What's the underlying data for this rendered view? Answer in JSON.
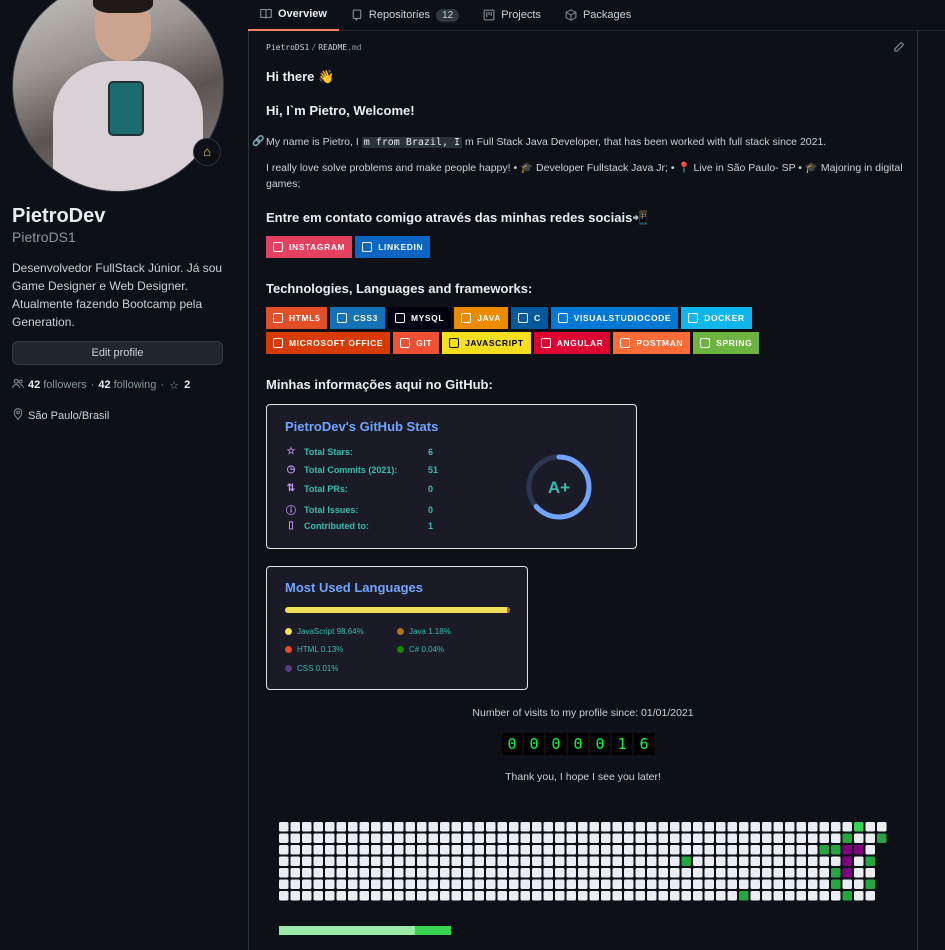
{
  "nav": {
    "tabs": [
      {
        "label": "Overview",
        "icon": "book-icon",
        "active": true
      },
      {
        "label": "Repositories",
        "icon": "repo-icon",
        "count": "12"
      },
      {
        "label": "Projects",
        "icon": "project-icon"
      },
      {
        "label": "Packages",
        "icon": "package-icon"
      }
    ]
  },
  "profile": {
    "display_name": "PietroDev",
    "username": "PietroDS1",
    "bio": "Desenvolvedor FullStack Júnior. Já sou Game Designer e Web Designer. Atualmente fazendo Bootcamp pela Generation.",
    "edit_label": "Edit profile",
    "followers_count": "42",
    "followers_label": "followers",
    "following_count": "42",
    "following_label": "following",
    "stars": "2",
    "location": "São Paulo/Brasil",
    "status_emoji": "house-icon"
  },
  "readme": {
    "crumb_user": "PietroDS1",
    "crumb_sep": "/",
    "crumb_file": "README",
    "crumb_ext": ".md",
    "greeting": "Hi there 👋",
    "welcome": "Hi, I`m Pietro, Welcome!",
    "intro_1": "My name is Pietro, I",
    "intro_code_1": "m from Brazil, I",
    "intro_2": "m Full Stack Java Developer, that has been worked with full stack since 2021.",
    "about": "I really love solve problems and make people happy! • 🎓 Developer Fullstack Java Jr; • 📍 Live in São Paulo- SP • 🎓 Majoring in digital games;",
    "contact_heading": "Entre em contato comigo através das minhas redes sociais📲",
    "social_badges": [
      {
        "label": "INSTAGRAM",
        "color": "#E4405F",
        "icon": "instagram-icon"
      },
      {
        "label": "LINKEDIN",
        "color": "#0A66C2",
        "icon": "linkedin-icon"
      }
    ],
    "tech_heading": "Technologies, Languages and frameworks:",
    "tech_badges": [
      {
        "label": "HTML5",
        "color": "#E34F26"
      },
      {
        "label": "CSS3",
        "color": "#1572B6"
      },
      {
        "label": "MYSQL",
        "color": "#00000F"
      },
      {
        "label": "JAVA",
        "color": "#ED8B00"
      },
      {
        "label": "C",
        "color": "#00599C"
      },
      {
        "label": "VISUALSTUDIOCODE",
        "color": "#0078D4"
      },
      {
        "label": "DOCKER",
        "color": "#0DB7ED"
      },
      {
        "label": "MICROSOFT OFFICE",
        "color": "#D83B01"
      },
      {
        "label": "GIT",
        "color": "#F05033"
      },
      {
        "label": "JAVASCRIPT",
        "color": "#F7DF1E",
        "text_color": "#000000"
      },
      {
        "label": "ANGULAR",
        "color": "#DD0031"
      },
      {
        "label": "POSTMAN",
        "color": "#FF6C37"
      },
      {
        "label": "SPRING",
        "color": "#6DB33F"
      }
    ],
    "github_heading": "Minhas informações aqui no GitHub:",
    "stats": {
      "title": "PietroDev's GitHub Stats",
      "rows": [
        {
          "label": "Total Stars:",
          "value": "6",
          "icon": "star-icon"
        },
        {
          "label": "Total Commits (2021):",
          "value": "51",
          "icon": "history-icon"
        },
        {
          "label": "Total PRs:",
          "value": "0",
          "icon": "pull-request-icon"
        },
        {
          "label": "Total Issues:",
          "value": "0",
          "icon": "issue-icon"
        },
        {
          "label": "Contributed to:",
          "value": "1",
          "icon": "repo-icon"
        }
      ],
      "grade": "A+",
      "ring_color": "#70a5fd"
    },
    "languages": {
      "title": "Most Used Languages",
      "items": [
        {
          "label": "JavaScript 98.64%",
          "color": "#f1e05a",
          "percent": 98.64
        },
        {
          "label": "Java 1.18%",
          "color": "#b07219",
          "percent": 1.18
        },
        {
          "label": "HTML 0.13%",
          "color": "#e34c26",
          "percent": 0.13
        },
        {
          "label": "C# 0.04%",
          "color": "#178600",
          "percent": 0.04
        },
        {
          "label": "CSS 0.01%",
          "color": "#563d7c",
          "percent": 0.01
        }
      ]
    },
    "visits_label": "Number of visits to my profile since: 01/01/2021",
    "visits_digits": [
      "0",
      "0",
      "0",
      "0",
      "0",
      "1",
      "6"
    ],
    "thanks": "Thank you, I hope I see you later!"
  }
}
